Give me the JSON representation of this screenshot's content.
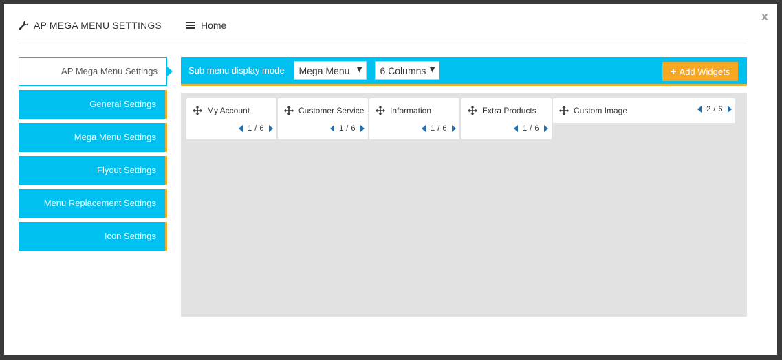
{
  "header": {
    "title": "AP MEGA MENU SETTINGS",
    "home_label": "Home",
    "close_label": "x"
  },
  "sidebar": {
    "items": [
      {
        "label": "AP Mega Menu Settings"
      },
      {
        "label": "General Settings"
      },
      {
        "label": "Mega Menu Settings"
      },
      {
        "label": "Flyout Settings"
      },
      {
        "label": "Menu Replacement Settings"
      },
      {
        "label": "Icon Settings"
      }
    ]
  },
  "toolbar": {
    "mode_label": "Sub menu display mode",
    "mode_value": "Mega Menu",
    "columns_value": "6 Columns",
    "caret": "▼",
    "add_label": "Add Widgets",
    "add_icon": "+"
  },
  "widgets": [
    {
      "title": "My Account",
      "page": "1 / 6"
    },
    {
      "title": "Customer Service",
      "page": "1 / 6"
    },
    {
      "title": "Information",
      "page": "1 / 6"
    },
    {
      "title": "Extra Products",
      "page": "1 / 6"
    },
    {
      "title": "Custom Image",
      "page": "2 / 6"
    }
  ],
  "colors": {
    "accent": "#00c0ef",
    "orange": "#f5a623",
    "arrow": "#1f6fb0"
  }
}
